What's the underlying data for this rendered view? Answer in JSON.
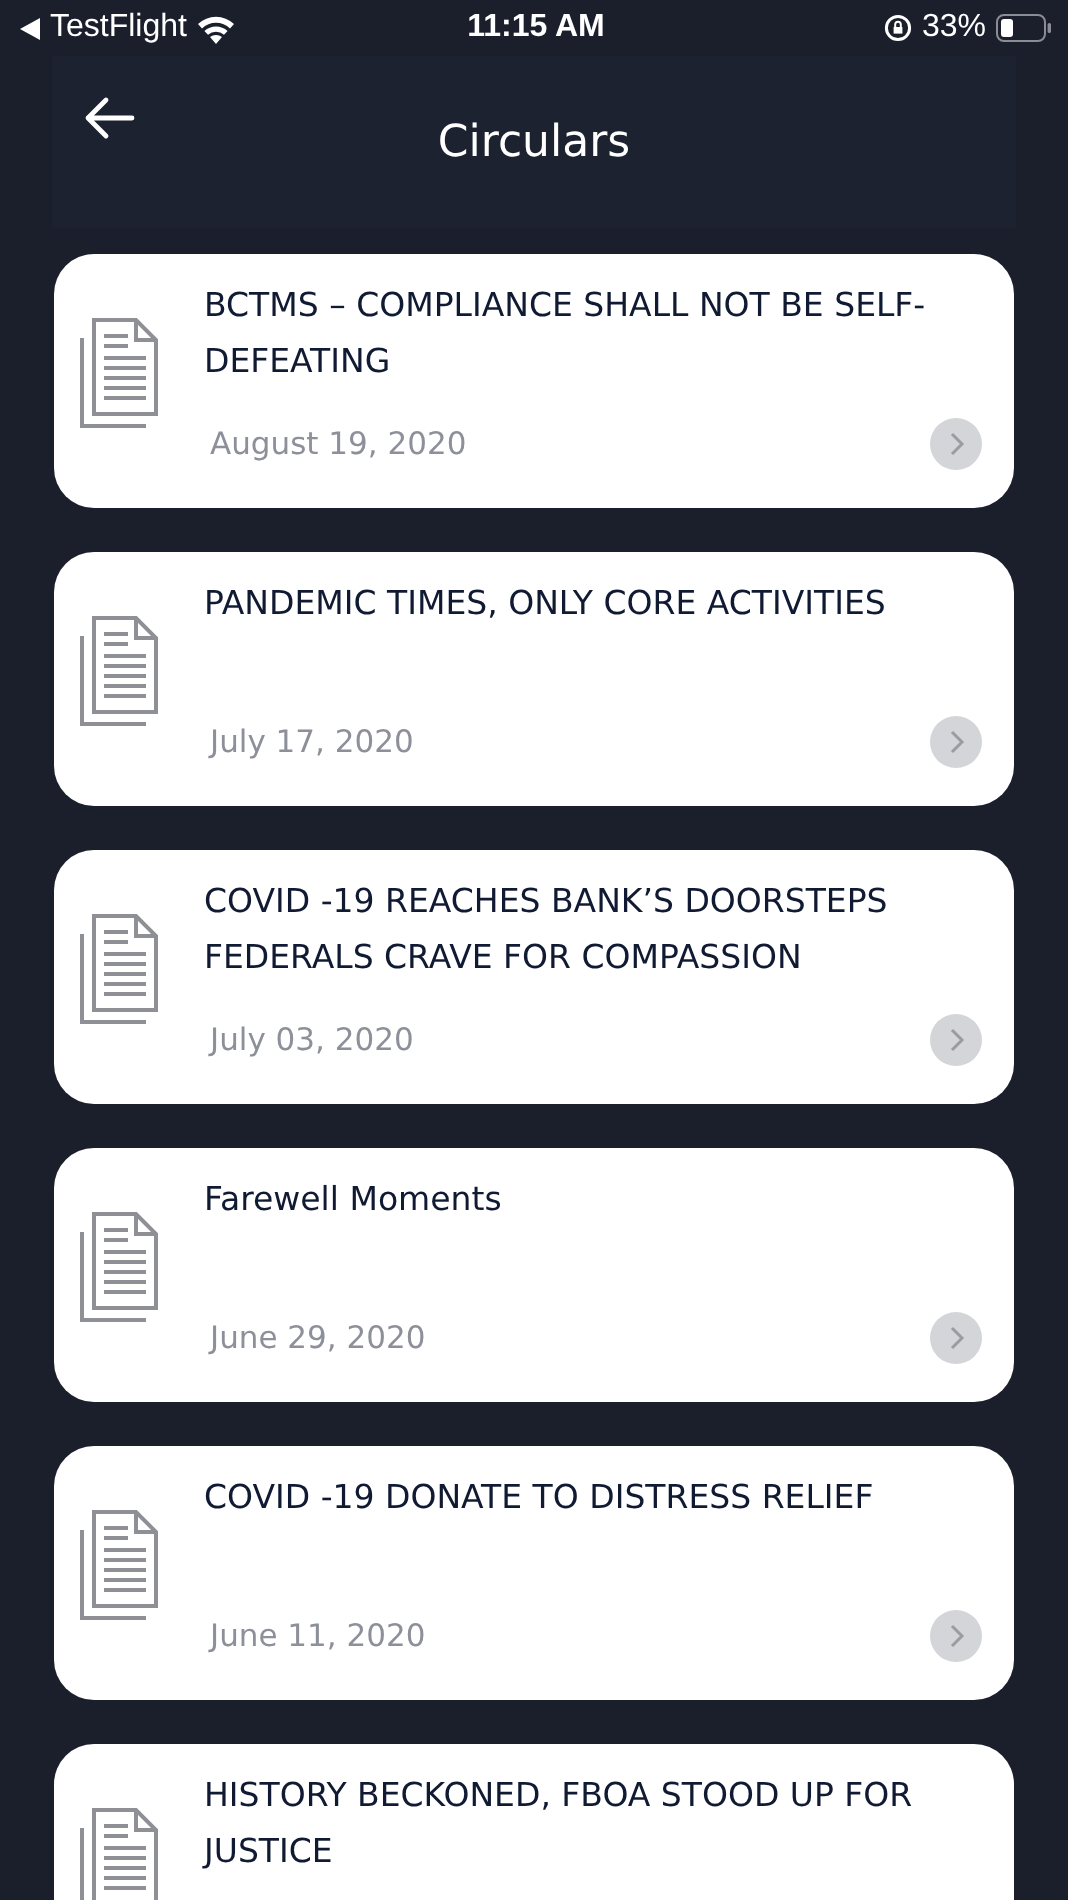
{
  "status_bar": {
    "back_app": "TestFlight",
    "time": "11:15 AM",
    "battery": "33%"
  },
  "header": {
    "title": "Circulars"
  },
  "circulars": [
    {
      "title": "BCTMS – COMPLIANCE SHALL NOT BE SELF-DEFEATING",
      "date": "August 19, 2020"
    },
    {
      "title": "PANDEMIC TIMES, ONLY CORE ACTIVITIES",
      "date": "July 17, 2020"
    },
    {
      "title": "COVID -19 REACHES BANK’S DOORSTEPS FEDERALS CRAVE FOR COMPASSION",
      "date": "July 03, 2020"
    },
    {
      "title": "Farewell Moments",
      "date": "June 29, 2020"
    },
    {
      "title": "COVID -19 DONATE TO DISTRESS RELIEF",
      "date": "June 11, 2020"
    },
    {
      "title": "HISTORY BECKONED, FBOA STOOD UP FOR JUSTICE"
    }
  ]
}
